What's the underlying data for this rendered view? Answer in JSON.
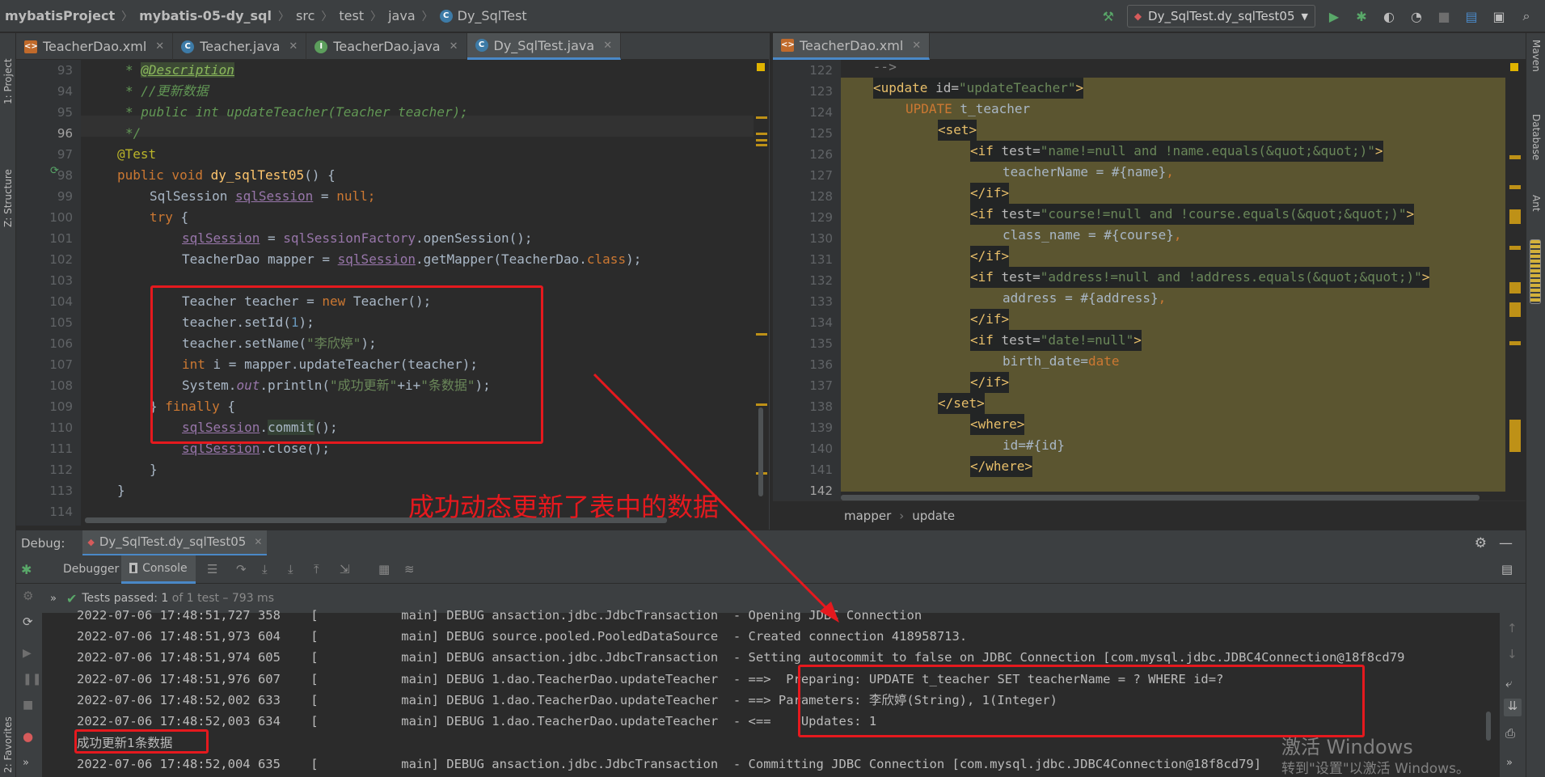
{
  "navbar": {
    "crumbs": [
      "mybatisProject",
      "mybatis-05-dy_sql",
      "src",
      "test",
      "java",
      "Dy_SqlTest"
    ],
    "run_config": "Dy_SqlTest.dy_sqlTest05"
  },
  "left_strip": {
    "project": "1: Project",
    "structure": "Z: Structure",
    "favorites": "2: Favorites"
  },
  "right_strip": {
    "maven": "Maven",
    "database": "Database",
    "ant": "Ant"
  },
  "left_tabs": [
    {
      "label": "TeacherDao.xml",
      "icon": "xml-file-icon"
    },
    {
      "label": "Teacher.java",
      "icon": "class-file-icon"
    },
    {
      "label": "TeacherDao.java",
      "icon": "interface-file-icon"
    },
    {
      "label": "Dy_SqlTest.java",
      "icon": "class-file-icon"
    }
  ],
  "right_tabs": [
    {
      "label": "TeacherDao.xml",
      "icon": "xml-file-icon"
    }
  ],
  "left_code": {
    "line_numbers": [
      "93",
      "94",
      "95",
      "96",
      "97",
      "98",
      "99",
      "100",
      "101",
      "102",
      "103",
      "104",
      "105",
      "106",
      "107",
      "108",
      "109",
      "110",
      "111",
      "112",
      "113",
      "114"
    ],
    "l93_star": "* ",
    "l93_tag": "@Description",
    "l94": "* //更新数据",
    "l95": "* public int updateTeacher(Teacher teacher);",
    "l96": "*/",
    "l97": "@Test",
    "l98_a": "public void ",
    "l98_fn": "dy_sqlTest05",
    "l98_b": "() {",
    "l99_a": "SqlSession ",
    "l99_var": "sqlSession",
    "l99_b": " = ",
    "l99_null": "null",
    "l99_c": ";",
    "l100_try": "try",
    "l100_b": " {",
    "l101_var": "sqlSession",
    "l101_b": " = ",
    "l101_fld": "sqlSessionFactory",
    "l101_c": ".openSession();",
    "l102_a": "TeacherDao mapper = ",
    "l102_var": "sqlSession",
    "l102_b": ".getMapper(TeacherDao.",
    "l102_cls": "class",
    "l102_c": ");",
    "l104_a": "Teacher teacher = ",
    "l104_new": "new",
    "l104_b": " Teacher();",
    "l105_a": "teacher.setId(",
    "l105_num": "1",
    "l105_b": ");",
    "l106_a": "teacher.setName(",
    "l106_str": "\"李欣婷\"",
    "l106_b": ");",
    "l107_int": "int",
    "l107_a": " i = mapper.updateTeacher(teacher);",
    "l108_a": "System.",
    "l108_out": "out",
    "l108_b": ".println(",
    "l108_s1": "\"成功更新\"",
    "l108_c": "+i+",
    "l108_s2": "\"条数据\"",
    "l108_d": ");",
    "l109_a": "} ",
    "l109_finally": "finally",
    "l109_b": " {",
    "l110_var": "sqlSession",
    "l110_b": ".",
    "l110_commit": "commit",
    "l110_c": "();",
    "l111_var": "sqlSession",
    "l111_b": ".close();",
    "l112": "}",
    "l113": "}"
  },
  "right_code": {
    "line_numbers": [
      "122",
      "123",
      "124",
      "125",
      "126",
      "127",
      "128",
      "129",
      "130",
      "131",
      "132",
      "133",
      "134",
      "135",
      "136",
      "137",
      "138",
      "139",
      "140",
      "141",
      "142"
    ],
    "l122": "-->",
    "l123_open": "<update ",
    "l123_attr": "id=",
    "l123_val": "\"updateTeacher\"",
    "l123_close": ">",
    "l124_kw": "UPDATE",
    "l124_b": " t_teacher",
    "l125": "<set>",
    "l126_open": "<if ",
    "l126_attr": "test=",
    "l126_val": "\"name!=null and !name.equals(&quot;&quot;)\"",
    "l126_close": ">",
    "l127_a": "teacherName = #{name}",
    "l127_b": ",",
    "l128": "</if>",
    "l129_open": "<if ",
    "l129_attr": "test=",
    "l129_val": "\"course!=null and !course.equals(&quot;&quot;)\"",
    "l129_close": ">",
    "l130_a": "class_name = #{course}",
    "l130_b": ",",
    "l131": "</if>",
    "l132_open": "<if ",
    "l132_attr": "test=",
    "l132_val": "\"address!=null and !address.equals(&quot;&quot;)\"",
    "l132_close": ">",
    "l133_a": "address = #{address}",
    "l133_b": ",",
    "l134": "</if>",
    "l135_open": "<if ",
    "l135_attr": "test=",
    "l135_val": "\"date!=null\"",
    "l135_close": ">",
    "l136_a": "birth_date=",
    "l136_b": "date",
    "l137": "</if>",
    "l138": "</set>",
    "l139": "<where>",
    "l140": "id=#{id}",
    "l141": "</where>"
  },
  "xml_breadcrumb": [
    "mapper",
    "update"
  ],
  "debug": {
    "label": "Debug:",
    "session_tab": "Dy_SqlTest.dy_sqlTest05",
    "debugger_tab": "Debugger",
    "console_tab": "Console",
    "tests_passed_a": "Tests passed: ",
    "tests_passed_b": "1",
    "tests_passed_c": " of 1 test – 793 ms"
  },
  "console_lines": [
    "2022-07-06 17:48:51,727 358    [           main] DEBUG ansaction.jdbc.JdbcTransaction  - Opening JDBC Connection",
    "2022-07-06 17:48:51,973 604    [           main] DEBUG source.pooled.PooledDataSource  - Created connection 418958713.",
    "2022-07-06 17:48:51,974 605    [           main] DEBUG ansaction.jdbc.JdbcTransaction  - Setting autocommit to false on JDBC Connection [com.mysql.jdbc.JDBC4Connection@18f8cd79",
    "2022-07-06 17:48:51,976 607    [           main] DEBUG 1.dao.TeacherDao.updateTeacher  - ==>  Preparing: UPDATE t_teacher SET teacherName = ? WHERE id=?",
    "2022-07-06 17:48:52,002 633    [           main] DEBUG 1.dao.TeacherDao.updateTeacher  - ==> Parameters: 李欣婷(String), 1(Integer)",
    "2022-07-06 17:48:52,003 634    [           main] DEBUG 1.dao.TeacherDao.updateTeacher  - <==    Updates: 1",
    "成功更新1条数据",
    "2022-07-06 17:48:52,004 635    [           main] DEBUG ansaction.jdbc.JdbcTransaction  - Committing JDBC Connection [com.mysql.jdbc.JDBC4Connection@18f8cd79]"
  ],
  "annotation": "成功动态更新了表中的数据",
  "watermark": {
    "line1": "激活 Windows",
    "line2": "转到\"设置\"以激活 Windows。"
  },
  "colors": {
    "accent_blue": "#4a88c7",
    "annotation_red": "#e5191e",
    "run_green": "#59a869"
  }
}
